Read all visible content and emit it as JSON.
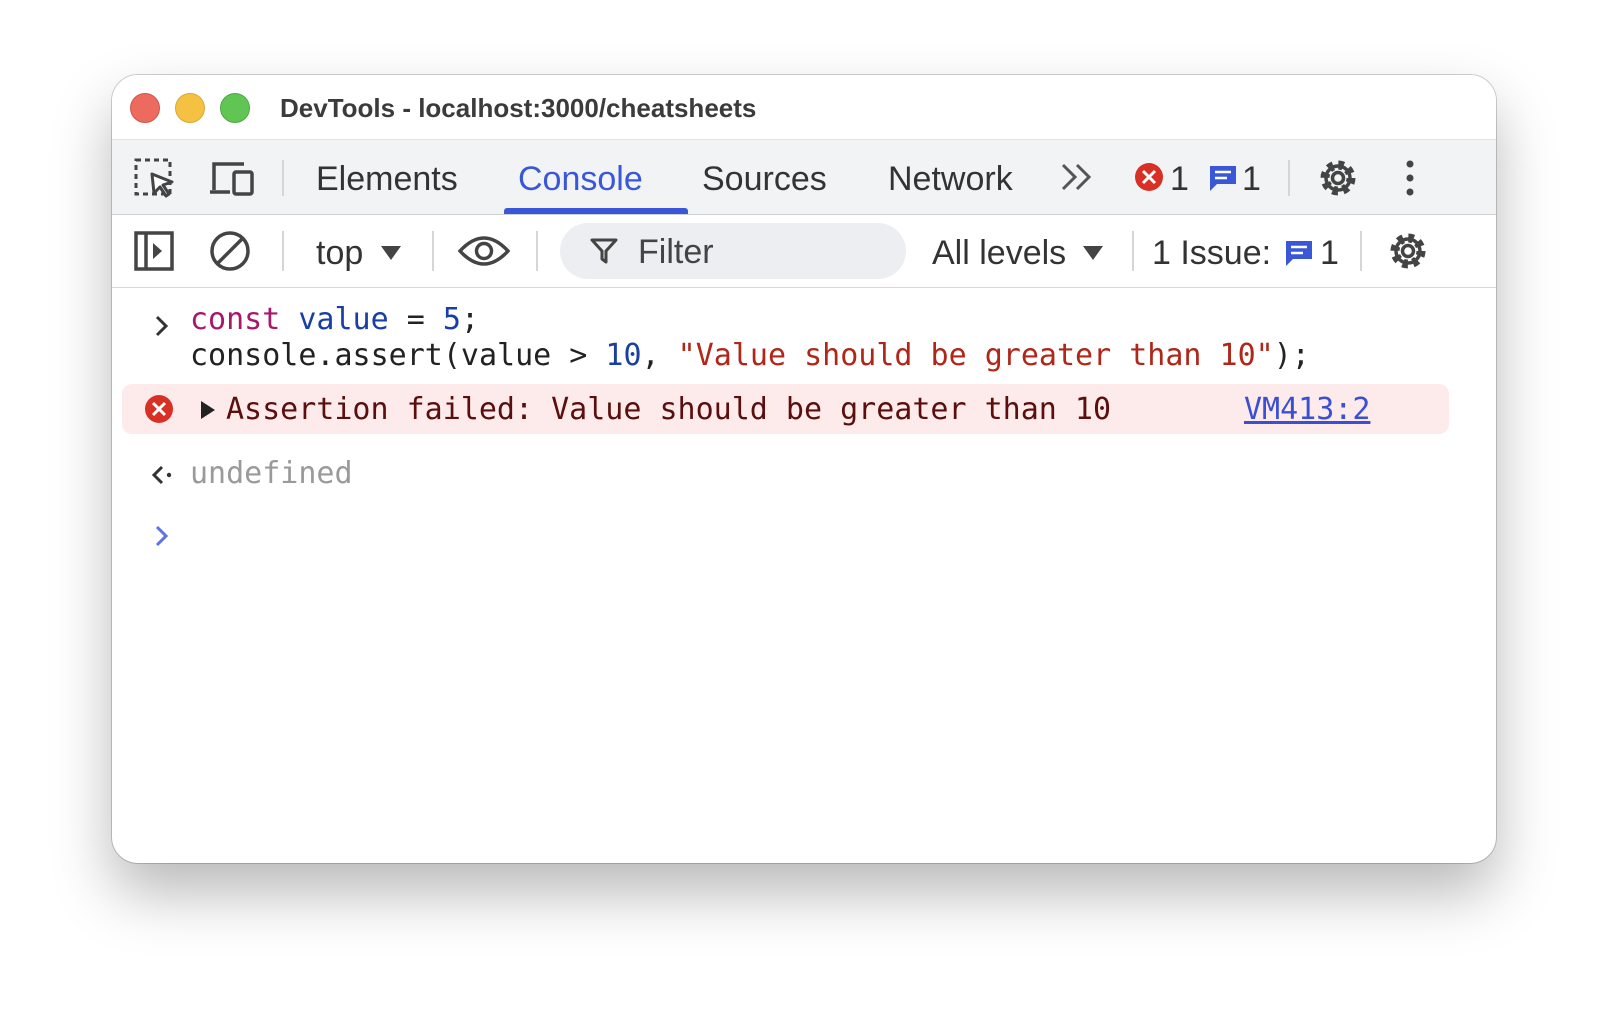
{
  "window": {
    "title": "DevTools - localhost:3000/cheatsheets"
  },
  "tabs": [
    {
      "label": "Elements",
      "active": false
    },
    {
      "label": "Console",
      "active": true
    },
    {
      "label": "Sources",
      "active": false
    },
    {
      "label": "Network",
      "active": false
    }
  ],
  "status": {
    "error_count": "1",
    "message_count": "1"
  },
  "toolbar": {
    "context": "top",
    "filter_placeholder": "Filter",
    "levels": "All levels",
    "issues_label": "1 Issue:",
    "issues_count": "1"
  },
  "console": {
    "input_line1": {
      "keyword": "const",
      "var": "value",
      "op": " = ",
      "num": "5",
      "end": ";"
    },
    "input_line2": {
      "pre": "console.assert(value > ",
      "num": "10",
      "mid": ", ",
      "str": "\"Value should be greater than 10\"",
      "end": ");"
    },
    "error_message": "Assertion failed: Value should be greater than 10",
    "error_source": "VM413:2",
    "result": "undefined"
  },
  "colors": {
    "accent": "#3a57d8",
    "error": "#d93025",
    "error_bg": "#fcebea"
  }
}
